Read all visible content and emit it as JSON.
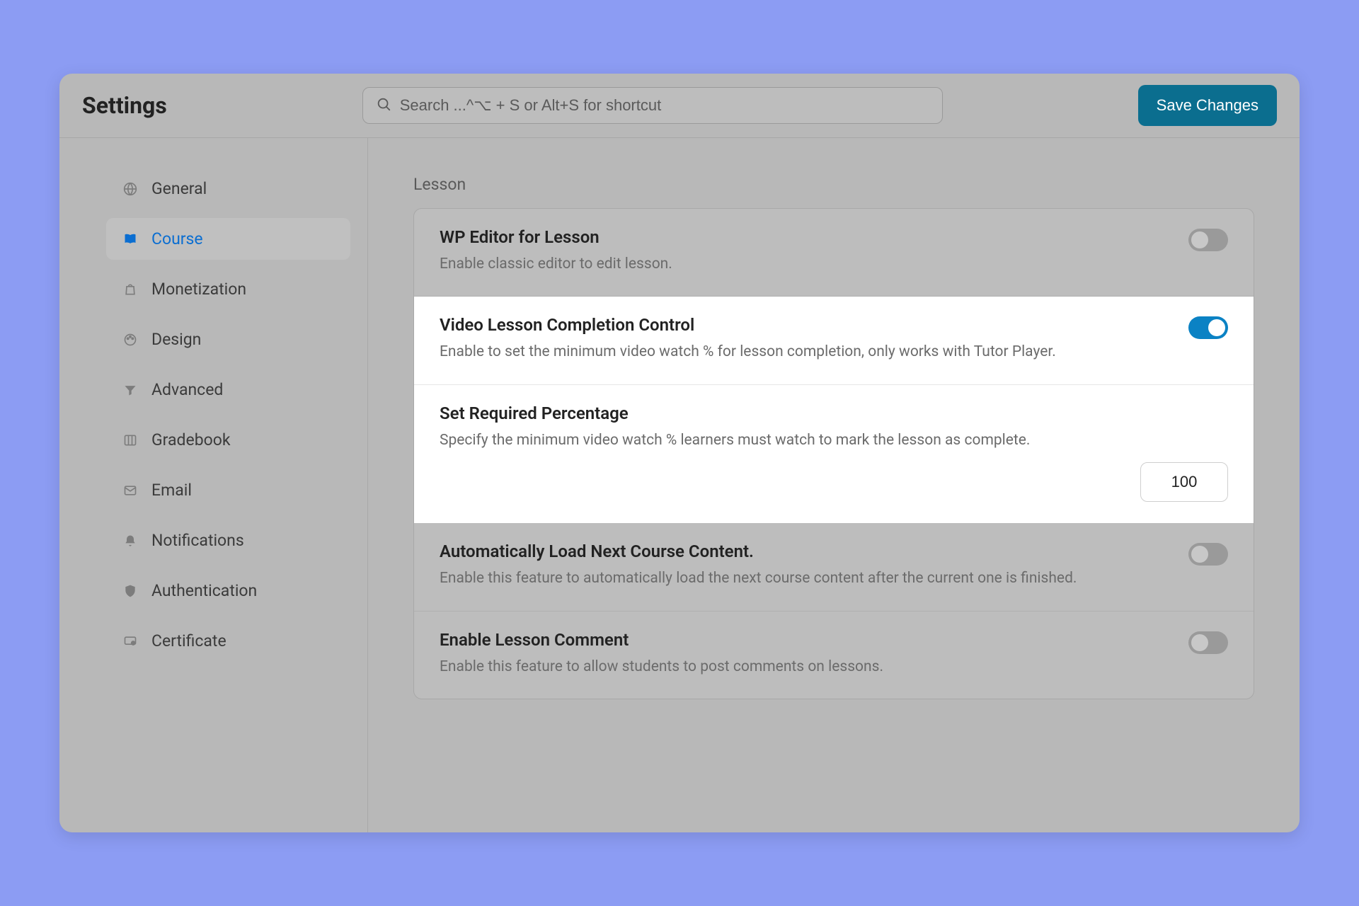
{
  "header": {
    "title": "Settings",
    "search_placeholder": "Search ...^⌥ + S or Alt+S for shortcut",
    "save_label": "Save Changes"
  },
  "sidebar": {
    "items": [
      {
        "label": "General",
        "icon": "globe",
        "active": false
      },
      {
        "label": "Course",
        "icon": "book",
        "active": true
      },
      {
        "label": "Monetization",
        "icon": "bag",
        "active": false
      },
      {
        "label": "Design",
        "icon": "palette",
        "active": false
      },
      {
        "label": "Advanced",
        "icon": "funnel",
        "active": false
      },
      {
        "label": "Gradebook",
        "icon": "columns",
        "active": false
      },
      {
        "label": "Email",
        "icon": "mail",
        "active": false
      },
      {
        "label": "Notifications",
        "icon": "bell",
        "active": false
      },
      {
        "label": "Authentication",
        "icon": "shield",
        "active": false
      },
      {
        "label": "Certificate",
        "icon": "badge",
        "active": false
      }
    ]
  },
  "main": {
    "section_label": "Lesson",
    "rows": [
      {
        "title": "WP Editor for Lesson",
        "desc": "Enable classic editor to edit lesson.",
        "toggle": "off"
      },
      {
        "title": "Video Lesson Completion Control",
        "desc": "Enable to set the minimum video watch % for lesson completion, only works with Tutor Player.",
        "toggle": "on"
      },
      {
        "title": "Set Required Percentage",
        "desc": "Specify the minimum video watch % learners must watch to mark the lesson as complete.",
        "value": "100"
      },
      {
        "title": "Automatically Load Next Course Content.",
        "desc": "Enable this feature to automatically load the next course content after the current one is finished.",
        "toggle": "off"
      },
      {
        "title": "Enable Lesson Comment",
        "desc": "Enable this feature to allow students to post comments on lessons.",
        "toggle": "off"
      }
    ]
  }
}
